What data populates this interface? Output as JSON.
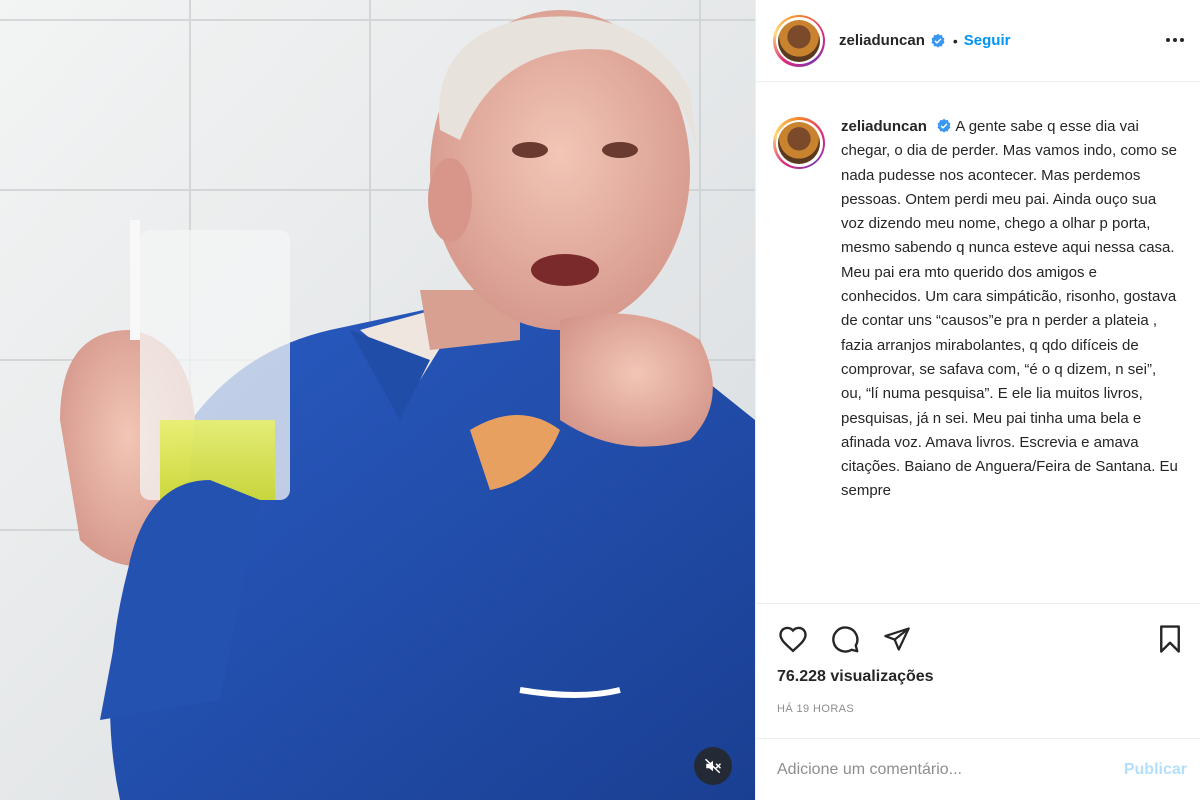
{
  "post": {
    "username": "zeliaduncan",
    "follow_label": "Seguir",
    "separator": "•",
    "caption_text": "A gente sabe q esse dia vai chegar, o dia de perder. Mas vamos indo, como se nada pudesse nos acontecer. Mas perdemos pessoas. Ontem perdi meu pai. Ainda ouço sua voz dizendo meu nome, chego a olhar p porta, mesmo sabendo q nunca esteve aqui nessa casa. Meu pai era mto querido dos amigos e conhecidos. Um cara simpáticão, risonho, gostava de contar uns “causos”e pra n perder a plateia , fazia arranjos mirabolantes, q qdo difíceis de comprovar, se safava com, “é o q dizem, n sei”, ou, “lí numa pesquisa”. E ele lia muitos livros, pesquisas, já n sei. Meu pai tinha uma bela e afinada voz. Amava livros. Escrevia e amava citações. Baiano de Anguera/Feira de Santana. Eu sempre",
    "views": "76.228 visualizações",
    "time_ago": "HÁ 19 HORAS"
  },
  "comment": {
    "placeholder": "Adicione um comentário...",
    "publish_label": "Publicar"
  },
  "icons": {
    "verified": "verified-badge-icon",
    "more": "more-options-icon",
    "like": "heart-icon",
    "comment": "comment-icon",
    "share": "paper-plane-icon",
    "save": "bookmark-icon",
    "mute": "muted-speaker-icon"
  },
  "colors": {
    "accent": "#0095f6",
    "publish_disabled": "#b2dffc",
    "muted_text": "#8e8e8e",
    "text": "#262626",
    "divider": "#efefef"
  }
}
